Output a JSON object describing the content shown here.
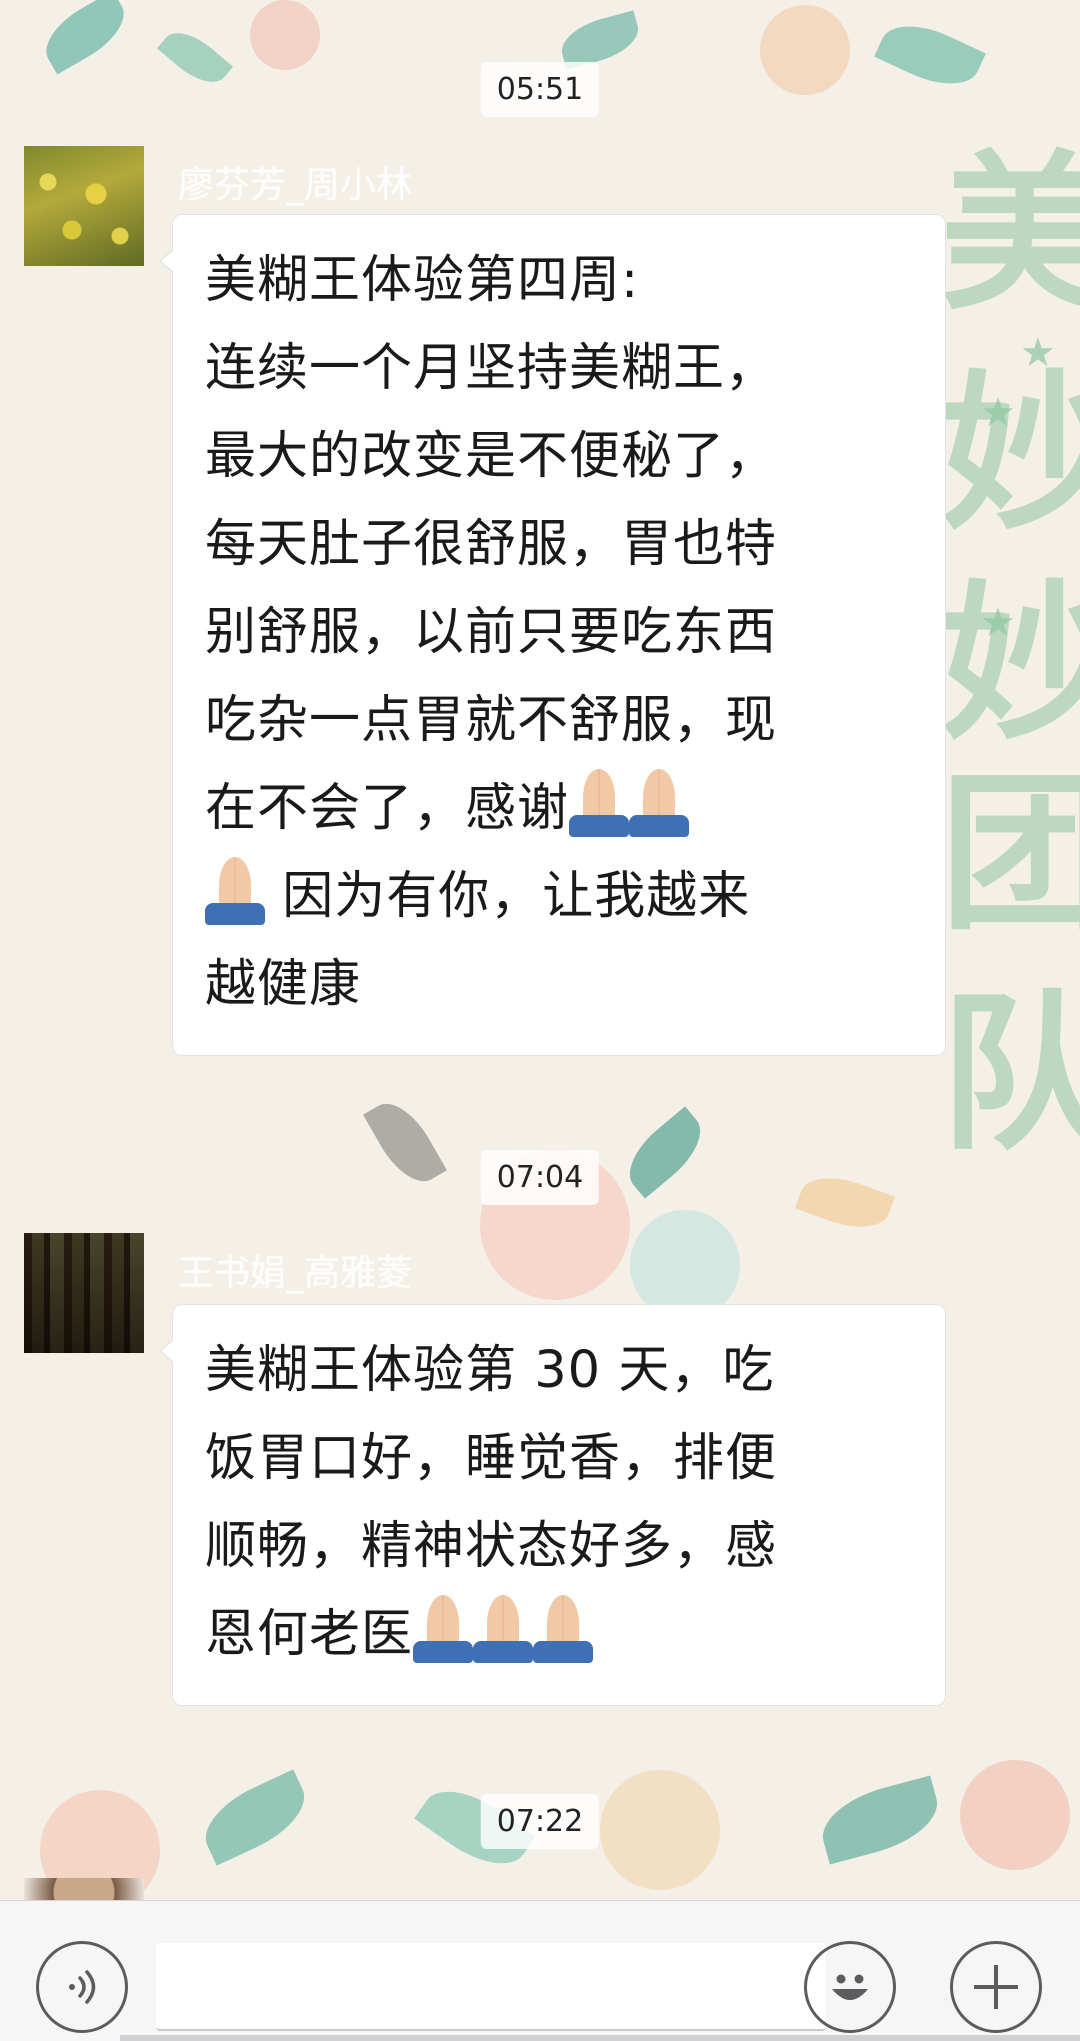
{
  "messages": [
    {
      "time": "05:51",
      "sender": "廖芬芳_周小林",
      "lines": [
        "美糊王体验第四周:",
        "连续一个月坚持美糊王，",
        "最大的改变是不便秘了，",
        "每天肚子很舒服，胃也特",
        "别舒服，以前只要吃东西",
        "吃杂一点胃就不舒服，现",
        "在不会了，感谢",
        " 因为有你，让我越来",
        "越健康"
      ]
    },
    {
      "time": "07:04",
      "sender": "王书娟_高雅菱",
      "lines": [
        "美糊王体验第 30 天，吃",
        "饭胃口好，睡觉香，排便",
        "顺畅，精神状态好多，感",
        "恩何老医"
      ]
    },
    {
      "time": "07:22"
    }
  ],
  "background": {
    "side_text": [
      "美",
      "妙",
      "妙",
      "团",
      "队"
    ]
  },
  "icons": {
    "voice": "voice-icon",
    "emoji": "emoji-icon",
    "plus": "plus-icon",
    "pray": "folded-hands-emoji"
  }
}
